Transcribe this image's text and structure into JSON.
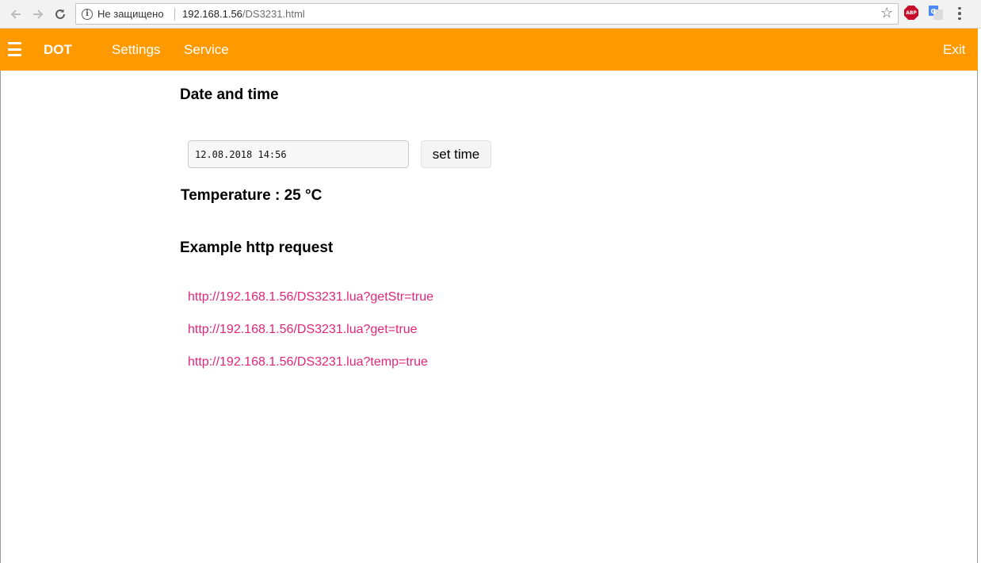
{
  "browser": {
    "security_label": "Не защищено",
    "url_host": "192.168.1.56",
    "url_path": "/DS3231.html",
    "abp_badge": "ABP"
  },
  "topnav": {
    "brand": "DOT",
    "items": [
      {
        "label": "Settings"
      },
      {
        "label": "Service"
      }
    ],
    "exit_label": "Exit",
    "accent_color": "#ff9900"
  },
  "datetime_section": {
    "heading": "Date and time",
    "input_value": "12.08.2018 14:56",
    "set_button_label": "set time"
  },
  "temperature": {
    "text": "Temperature : 25 °C"
  },
  "requests_section": {
    "heading": "Example http request",
    "links": [
      {
        "text": "http://192.168.1.56/DS3231.lua?getStr=true"
      },
      {
        "text": "http://192.168.1.56/DS3231.lua?get=true"
      },
      {
        "text": "http://192.168.1.56/DS3231.lua?temp=true"
      }
    ],
    "link_color": "#e0257a"
  }
}
